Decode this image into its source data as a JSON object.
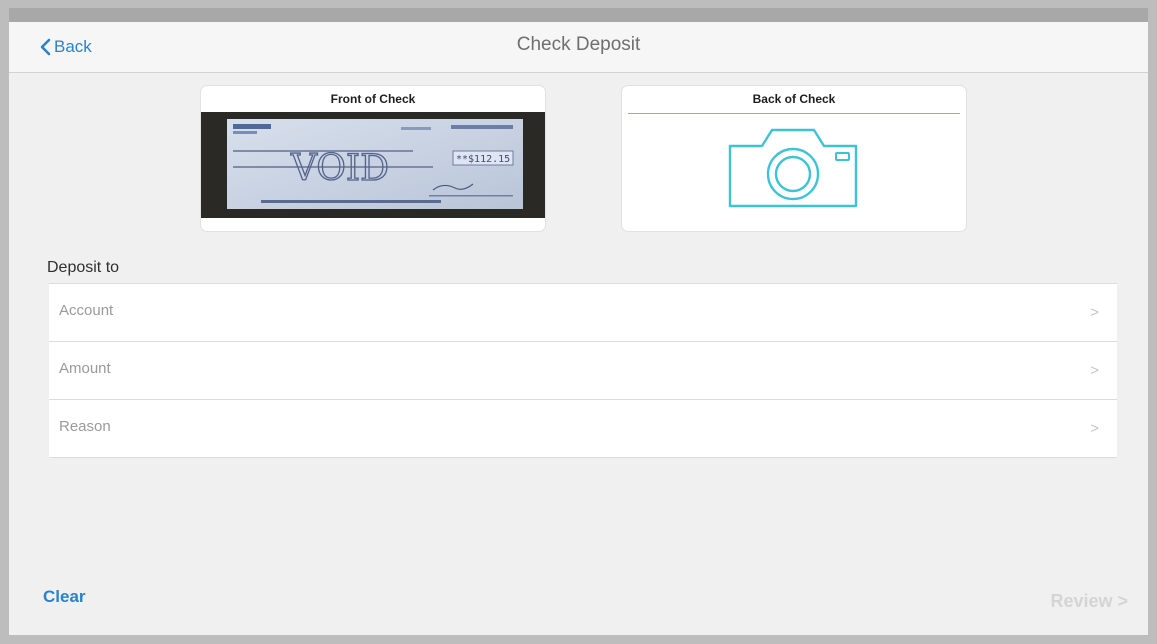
{
  "nav": {
    "back_label": "Back",
    "title": "Check Deposit"
  },
  "checks": {
    "front_title": "Front of Check",
    "back_title": "Back of Check",
    "front_amount": "**$112.15",
    "front_void_text": "VOID"
  },
  "deposit": {
    "section_label": "Deposit to",
    "rows": [
      {
        "label": "Account",
        "chevron": ">"
      },
      {
        "label": "Amount",
        "chevron": ">"
      },
      {
        "label": "Reason",
        "chevron": ">"
      }
    ]
  },
  "footer": {
    "clear_label": "Clear",
    "review_label": "Review >"
  },
  "colors": {
    "accent": "#2c82c9",
    "camera": "#3cc3d6",
    "disabled": "#d4d4d4"
  }
}
